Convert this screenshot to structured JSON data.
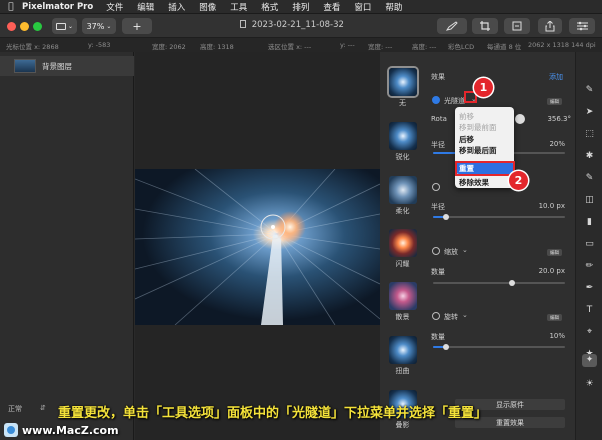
{
  "menubar": {
    "app_name": "Pixelmator Pro",
    "items": [
      "文件",
      "编辑",
      "插入",
      "图像",
      "工具",
      "格式",
      "排列",
      "查看",
      "窗口",
      "帮助"
    ]
  },
  "toolbar": {
    "zoom": "37%",
    "add_label": "+",
    "document_title": "2023-02-21_11-08-32"
  },
  "infobar": {
    "pos_x": "光标位置 x:  2868",
    "pos_y": "y:  -583",
    "width": "宽度: 2062",
    "height": "高度: 1318",
    "sel_pos": "选区位置 x:  ---",
    "sel_y": "y:  ---",
    "sel_w": "宽度: ---",
    "sel_h": "高度: ---",
    "color": "彩色LCD",
    "bits": "每通道 8 位",
    "dims": "2062 x 1318 144 dpi"
  },
  "layers": {
    "items": [
      {
        "name": "背景图层"
      }
    ],
    "blend_mode": "正常"
  },
  "effects_browser": {
    "items": [
      {
        "label": "无"
      },
      {
        "label": "锐化"
      },
      {
        "label": "柔化"
      },
      {
        "label": "闪耀"
      },
      {
        "label": "散景"
      },
      {
        "label": "扭曲"
      },
      {
        "label": "叠影"
      }
    ]
  },
  "options": {
    "header": "效果",
    "add_label": "添加",
    "effects": [
      {
        "name": "光隧道",
        "enabled": true,
        "edit_label": "编辑"
      },
      {
        "name": "缩放",
        "enabled": false,
        "edit_label": "编辑"
      },
      {
        "name": "旋转",
        "enabled": false,
        "edit_label": "编辑"
      }
    ],
    "tunnel_rotation_label": "Rota",
    "tunnel_rotation_value": "356.3°",
    "tunnel_param_label": "半径",
    "tunnel_param_value": "20%",
    "tunnel_param_level": 0.2,
    "soften_radius_label": "半径",
    "soften_radius_value": "10.0 px",
    "soften_radius_level": 0.1,
    "zoom_amount_label": "数量",
    "zoom_amount_value": "20.0 px",
    "zoom_amount_level": 0.6,
    "spin_amount_label": "数量",
    "spin_amount_value": "10%",
    "spin_amount_level": 0.1,
    "show_original": "显示原件",
    "reset_effects": "重置效果"
  },
  "context_menu": {
    "items": [
      {
        "label": "前移",
        "enabled": false
      },
      {
        "label": "移到最前面",
        "enabled": false
      },
      {
        "label": "后移",
        "enabled": true
      },
      {
        "label": "移到最后面",
        "enabled": true
      },
      {
        "label": "重置",
        "enabled": true,
        "highlighted": true
      },
      {
        "label": "移除效果",
        "enabled": true
      }
    ]
  },
  "annotations": {
    "callout_1": "1",
    "callout_2": "2",
    "caption": "重置更改，单击「工具选项」面板中的「光隧道」下拉菜单并选择「重置」",
    "watermark": "www.MacZ.com"
  },
  "colors": {
    "accent": "#2f7ae5",
    "callout_red": "#e3262c",
    "caption_yellow": "#f4e23a"
  }
}
